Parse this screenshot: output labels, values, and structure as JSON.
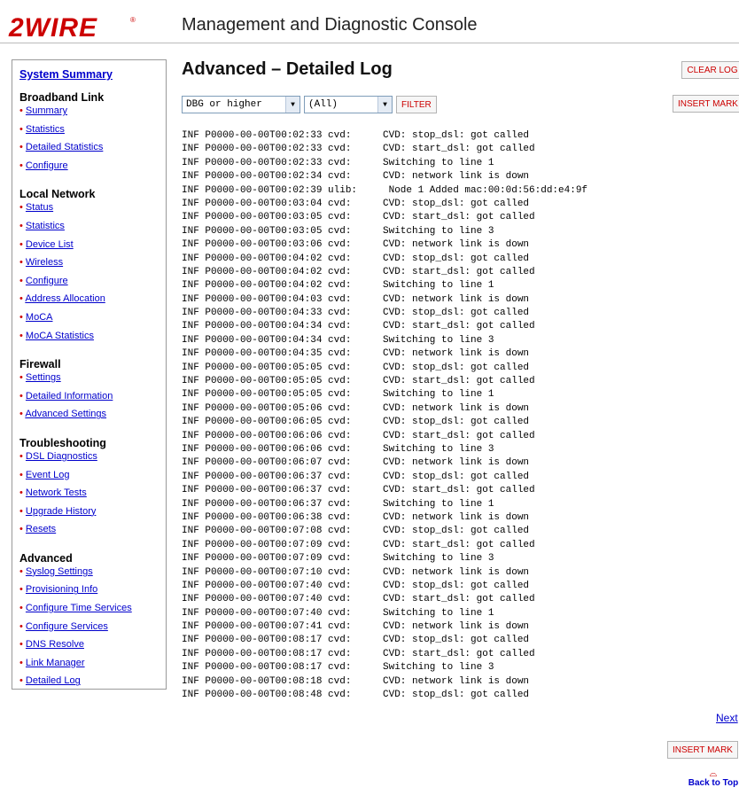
{
  "header": {
    "logo_text": "2WIRE",
    "title": "Management and Diagnostic Console"
  },
  "sidebar": {
    "summary_link": "System Summary",
    "sections": [
      {
        "title": "Broadband Link",
        "items": [
          "Summary",
          "Statistics",
          "Detailed Statistics",
          "Configure"
        ]
      },
      {
        "title": "Local Network",
        "items": [
          "Status",
          "Statistics",
          "Device List",
          "Wireless",
          "Configure",
          "Address Allocation",
          "MoCA",
          "MoCA Statistics"
        ]
      },
      {
        "title": "Firewall",
        "items": [
          "Settings",
          "Detailed Information",
          "Advanced Settings"
        ]
      },
      {
        "title": "Troubleshooting",
        "items": [
          "DSL Diagnostics",
          "Event Log",
          "Network Tests",
          "Upgrade History",
          "Resets"
        ]
      },
      {
        "title": "Advanced",
        "items": [
          "Syslog Settings",
          "Provisioning Info",
          "Configure Time Services",
          "Configure Services",
          "DNS Resolve",
          "Link Manager",
          "Detailed Log"
        ]
      }
    ]
  },
  "main": {
    "title": "Advanced – Detailed Log",
    "level_select": "DBG or higher",
    "category_select": "(All)",
    "filter_label": "FILTER",
    "clear_log_label": "CLEAR LOG",
    "insert_mark_label": "INSERT MARK",
    "next_label": "Next",
    "back_to_top_label": "Back to Top"
  },
  "log": [
    [
      "INF P0000-00-00T00:02:33 cvd:",
      "CVD: stop_dsl: got called"
    ],
    [
      "INF P0000-00-00T00:02:33 cvd:",
      "CVD: start_dsl: got called"
    ],
    [
      "INF P0000-00-00T00:02:33 cvd:",
      "Switching to line 1"
    ],
    [
      "INF P0000-00-00T00:02:34 cvd:",
      "CVD: network link is down"
    ],
    [
      "INF P0000-00-00T00:02:39 ulib:",
      " Node 1 Added mac:00:0d:56:dd:e4:9f"
    ],
    [
      "INF P0000-00-00T00:03:04 cvd:",
      "CVD: stop_dsl: got called"
    ],
    [
      "INF P0000-00-00T00:03:05 cvd:",
      "CVD: start_dsl: got called"
    ],
    [
      "INF P0000-00-00T00:03:05 cvd:",
      "Switching to line 3"
    ],
    [
      "INF P0000-00-00T00:03:06 cvd:",
      "CVD: network link is down"
    ],
    [
      "INF P0000-00-00T00:04:02 cvd:",
      "CVD: stop_dsl: got called"
    ],
    [
      "INF P0000-00-00T00:04:02 cvd:",
      "CVD: start_dsl: got called"
    ],
    [
      "INF P0000-00-00T00:04:02 cvd:",
      "Switching to line 1"
    ],
    [
      "INF P0000-00-00T00:04:03 cvd:",
      "CVD: network link is down"
    ],
    [
      "INF P0000-00-00T00:04:33 cvd:",
      "CVD: stop_dsl: got called"
    ],
    [
      "INF P0000-00-00T00:04:34 cvd:",
      "CVD: start_dsl: got called"
    ],
    [
      "INF P0000-00-00T00:04:34 cvd:",
      "Switching to line 3"
    ],
    [
      "INF P0000-00-00T00:04:35 cvd:",
      "CVD: network link is down"
    ],
    [
      "INF P0000-00-00T00:05:05 cvd:",
      "CVD: stop_dsl: got called"
    ],
    [
      "INF P0000-00-00T00:05:05 cvd:",
      "CVD: start_dsl: got called"
    ],
    [
      "INF P0000-00-00T00:05:05 cvd:",
      "Switching to line 1"
    ],
    [
      "INF P0000-00-00T00:05:06 cvd:",
      "CVD: network link is down"
    ],
    [
      "INF P0000-00-00T00:06:05 cvd:",
      "CVD: stop_dsl: got called"
    ],
    [
      "INF P0000-00-00T00:06:06 cvd:",
      "CVD: start_dsl: got called"
    ],
    [
      "INF P0000-00-00T00:06:06 cvd:",
      "Switching to line 3"
    ],
    [
      "INF P0000-00-00T00:06:07 cvd:",
      "CVD: network link is down"
    ],
    [
      "INF P0000-00-00T00:06:37 cvd:",
      "CVD: stop_dsl: got called"
    ],
    [
      "INF P0000-00-00T00:06:37 cvd:",
      "CVD: start_dsl: got called"
    ],
    [
      "INF P0000-00-00T00:06:37 cvd:",
      "Switching to line 1"
    ],
    [
      "INF P0000-00-00T00:06:38 cvd:",
      "CVD: network link is down"
    ],
    [
      "INF P0000-00-00T00:07:08 cvd:",
      "CVD: stop_dsl: got called"
    ],
    [
      "INF P0000-00-00T00:07:09 cvd:",
      "CVD: start_dsl: got called"
    ],
    [
      "INF P0000-00-00T00:07:09 cvd:",
      "Switching to line 3"
    ],
    [
      "INF P0000-00-00T00:07:10 cvd:",
      "CVD: network link is down"
    ],
    [
      "INF P0000-00-00T00:07:40 cvd:",
      "CVD: stop_dsl: got called"
    ],
    [
      "INF P0000-00-00T00:07:40 cvd:",
      "CVD: start_dsl: got called"
    ],
    [
      "INF P0000-00-00T00:07:40 cvd:",
      "Switching to line 1"
    ],
    [
      "INF P0000-00-00T00:07:41 cvd:",
      "CVD: network link is down"
    ],
    [
      "INF P0000-00-00T00:08:17 cvd:",
      "CVD: stop_dsl: got called"
    ],
    [
      "INF P0000-00-00T00:08:17 cvd:",
      "CVD: start_dsl: got called"
    ],
    [
      "INF P0000-00-00T00:08:17 cvd:",
      "Switching to line 3"
    ],
    [
      "INF P0000-00-00T00:08:18 cvd:",
      "CVD: network link is down"
    ],
    [
      "INF P0000-00-00T00:08:48 cvd:",
      "CVD: stop_dsl: got called"
    ]
  ],
  "colors": {
    "brand_red": "#cc0000",
    "link_blue": "#0000cc",
    "border_gray": "#9a9a9a"
  },
  "icons": {
    "select_arrow": "dropdown-arrow-icon",
    "back_to_top": "back-to-top-icon"
  }
}
